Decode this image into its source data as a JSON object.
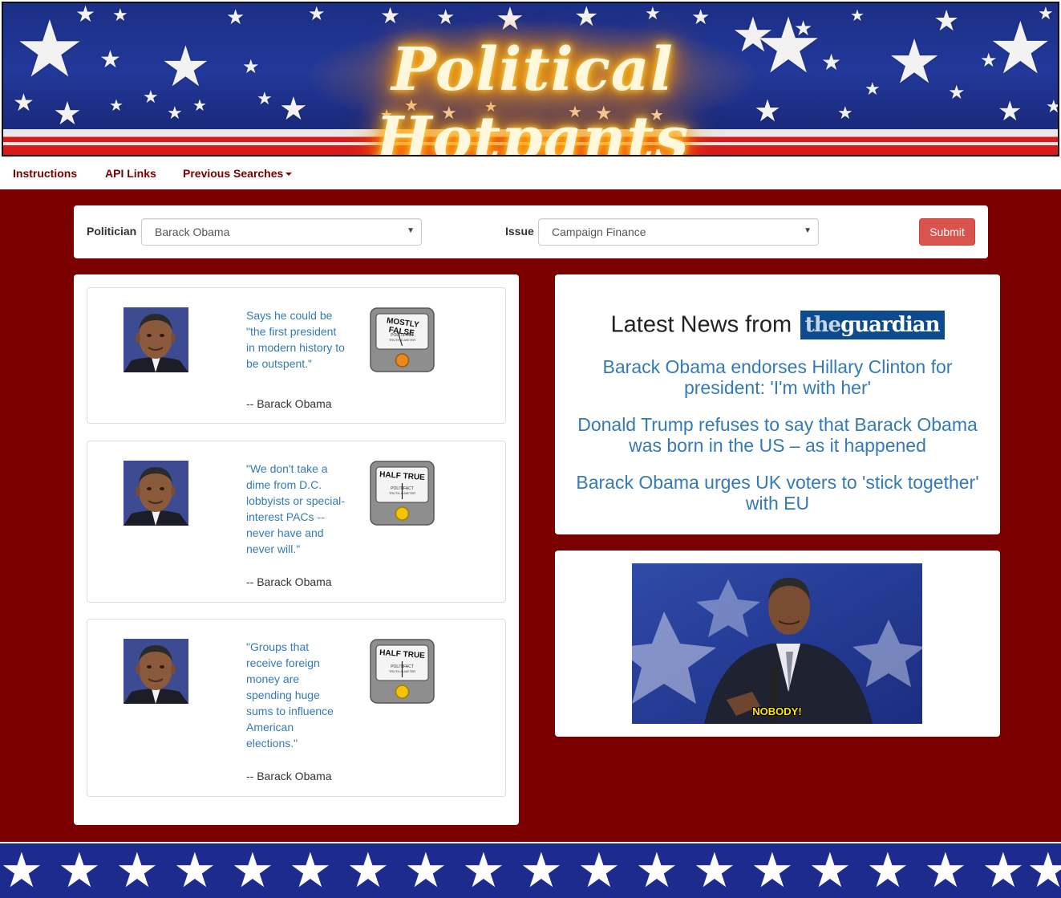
{
  "app": {
    "title": "Political Hotpants"
  },
  "nav": {
    "instructions": "Instructions",
    "api_links": "API Links",
    "previous_searches": "Previous Searches"
  },
  "search": {
    "politician_label": "Politician",
    "politician_value": "Barack Obama",
    "issue_label": "Issue",
    "issue_value": "Campaign Finance",
    "submit_label": "Submit"
  },
  "quotes": [
    {
      "text": "Says he could be \"the first president in modern history to be outspent.\"",
      "author": "-- Barack Obama",
      "rating": "MOSTLY FALSE",
      "rating_color": "#e88a1a"
    },
    {
      "text": "\"We don't take a dime from D.C. lobbyists or special-interest PACs -- never have and never will.\"",
      "author": "-- Barack Obama",
      "rating": "HALF TRUE",
      "rating_color": "#f5c400"
    },
    {
      "text": "\"Groups that receive foreign money are spending huge sums to influence American elections.\"",
      "author": "-- Barack Obama",
      "rating": "HALF TRUE",
      "rating_color": "#f5c400"
    }
  ],
  "meter": {
    "brand": "POLITIFACT",
    "sub": "TRUTH-O-METER"
  },
  "news": {
    "heading": "Latest News from",
    "logo_the": "the",
    "logo_guardian": "guardian",
    "items": [
      "Barack Obama endorses Hillary Clinton for president: 'I'm with her'",
      "Donald Trump refuses to say that Barack Obama was born in the US – as it happened",
      "Barack Obama urges UK voters to 'stick together' with EU"
    ]
  },
  "gif": {
    "caption": "NOBODY!"
  },
  "colors": {
    "page_background": "#7a0000",
    "link": "#337ab7",
    "submit": "#d9534f",
    "banner_blue": "#22389a"
  }
}
